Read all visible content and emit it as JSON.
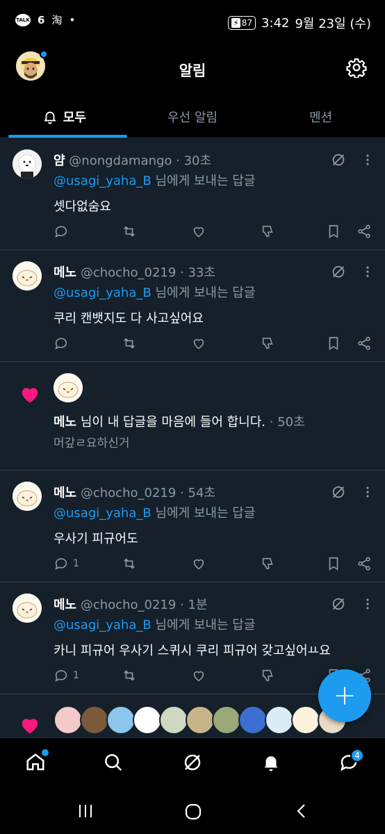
{
  "status_bar": {
    "battery": "87",
    "time": "3:42",
    "date": "9월 23일 (수)",
    "left_icons": [
      "kakaotalk-icon",
      "threads-icon",
      "taobao-icon",
      "dot"
    ],
    "taobao_glyph": "淘"
  },
  "header": {
    "title": "알림"
  },
  "tabs": [
    {
      "label": "모두",
      "active": true
    },
    {
      "label": "우선 알림",
      "active": false
    },
    {
      "label": "멘션",
      "active": false
    }
  ],
  "notifications": [
    {
      "type": "reply",
      "name": "얌",
      "handle": "@nongdamango",
      "time": "· 30초",
      "mention": "@usagi_yaha_B",
      "reply_suffix": "님에게 보내는 답글",
      "text": "셋다없숨요",
      "reply_count": ""
    },
    {
      "type": "reply",
      "name": "메노",
      "handle": "@chocho_0219",
      "time": "· 33초",
      "mention": "@usagi_yaha_B",
      "reply_suffix": "님에게 보내는 답글",
      "text": "쿠리 캔뱃지도 다 사고싶어요",
      "reply_count": ""
    },
    {
      "type": "like",
      "name": "메노",
      "text": "님이 내 답글을 마음에 들어 합니다.",
      "time": "· 50초",
      "sub": "머갚ㄹ요하신거"
    },
    {
      "type": "reply",
      "name": "메노",
      "handle": "@chocho_0219",
      "time": "· 54초",
      "mention": "@usagi_yaha_B",
      "reply_suffix": "님에게 보내는 답글",
      "text": "우사기 피규어도",
      "reply_count": "1"
    },
    {
      "type": "reply",
      "name": "메노",
      "handle": "@chocho_0219",
      "time": "· 1분",
      "mention": "@usagi_yaha_B",
      "reply_suffix": "님에게 보내는 답글",
      "text": "카니 피규어 우사기 스퀴시 쿠리 피규어 갖고싶어ㅛ요",
      "reply_count": "1"
    }
  ],
  "bottom_nav": {
    "messages_badge": "4"
  },
  "colors": {
    "accent": "#1d9bf0",
    "like": "#f91880",
    "background": "#15202b"
  }
}
